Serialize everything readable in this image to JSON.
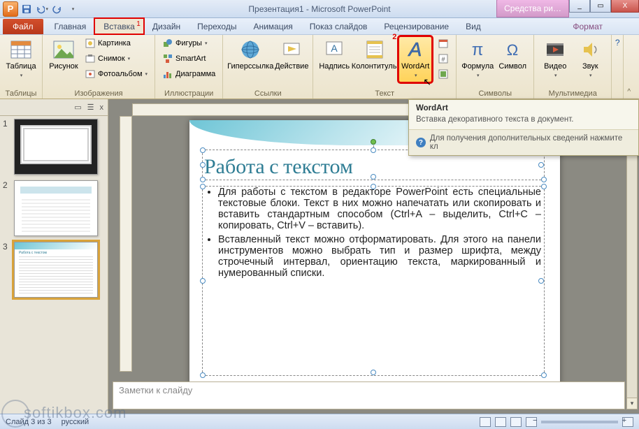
{
  "title": "Презентация1 - Microsoft PowerPoint",
  "app_icon_letter": "P",
  "extra_tab": "Средства ри…",
  "window_buttons": {
    "min": "_",
    "max": "▭",
    "close": "X"
  },
  "tabs": {
    "file": "Файл",
    "items": [
      "Главная",
      "Вставка",
      "Дизайн",
      "Переходы",
      "Анимация",
      "Показ слайдов",
      "Рецензирование",
      "Вид"
    ],
    "tool": "Формат",
    "red1": "1"
  },
  "ribbon": {
    "groups": {
      "tables": {
        "label": "Таблицы",
        "table": "Таблица"
      },
      "images": {
        "label": "Изображения",
        "picture": "Рисунок",
        "kartinka": "Картинка",
        "snimok": "Снимок",
        "photoalbum": "Фотоальбом"
      },
      "illus": {
        "label": "Иллюстрации",
        "figures": "Фигуры",
        "smartart": "SmartArt",
        "diagram": "Диаграмма"
      },
      "links": {
        "label": "Ссылки",
        "hyperlink": "Гиперссылка",
        "action": "Действие"
      },
      "text": {
        "label": "Текст",
        "nadpis": "Надпись",
        "kolont": "Колонтитулы",
        "wordart": "WordArt",
        "red2": "2"
      },
      "symbols": {
        "label": "Символы",
        "formula": "Формула",
        "symbol": "Символ"
      },
      "media": {
        "label": "Мультимедиа",
        "video": "Видео",
        "sound": "Звук"
      }
    }
  },
  "nav": {
    "tabs_x": "x",
    "slides": [
      {
        "num": "1"
      },
      {
        "num": "2"
      },
      {
        "num": "3"
      }
    ]
  },
  "slide": {
    "title": "Работа с текстом",
    "bullets": [
      "Для работы с текстом в редакторе PowerPoint есть специальные текстовые блоки. Текст в них можно напечатать или скопировать и вставить стандартным способом (Ctrl+A – выделить, Ctrl+C – копировать, Ctrl+V – вставить).",
      "Вставленный текст можно отформатировать. Для этого на панели инструментов можно выбрать тип и размер шрифта, между строчечный интервал, ориентацию текста, маркированный и нумерованный списки."
    ]
  },
  "notes_placeholder": "Заметки к слайду",
  "tooltip": {
    "head": "WordArt",
    "body": "Вставка декоративного текста в документ.",
    "foot": "Для получения дополнительных сведений нажмите кл"
  },
  "status": {
    "slide": "Слайд 3 из 3",
    "lang": "русский"
  },
  "watermark": "softikbox.com"
}
